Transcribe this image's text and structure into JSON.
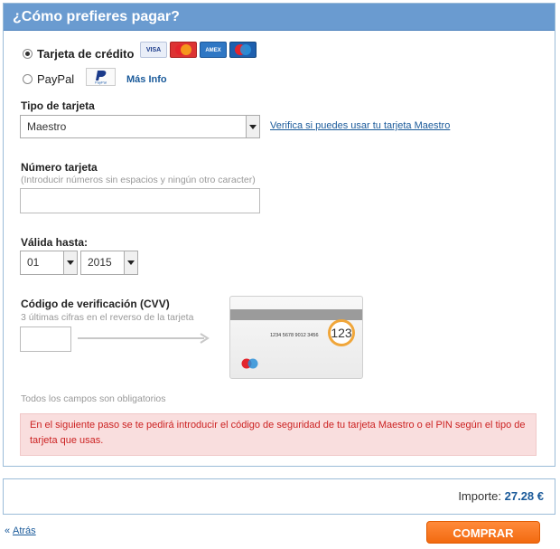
{
  "header": {
    "title": "¿Cómo prefieres pagar?"
  },
  "payment_methods": {
    "credit_card_label": "Tarjeta de crédito",
    "paypal_label": "PayPal",
    "more_info_link": "Más Info",
    "card_logos": [
      "VISA",
      "MasterCard",
      "AMEX",
      "Maestro"
    ],
    "paypal_logo_text": "PayPal",
    "selected": "Tarjeta de crédito"
  },
  "card_type": {
    "label": "Tipo de tarjeta",
    "value": "Maestro",
    "verify_link": "Verifica si puedes usar tu tarjeta Maestro"
  },
  "card_number": {
    "label": "Número tarjeta",
    "hint": "(Introducir números sin espacios y ningún otro caracter)",
    "value": ""
  },
  "expiry": {
    "label": "Válida hasta:",
    "month": "01",
    "year": "2015"
  },
  "cvv": {
    "label": "Código de verificación (CVV)",
    "hint": "3 últimas cifras en el reverso de la tarjeta",
    "value": "",
    "card_number_sample": "1234 5678 9012 3456",
    "code_sample": "123",
    "card_brand": "Maestro"
  },
  "required_note": "Todos los campos son obligatorios",
  "warning": "En el siguiente paso se te pedirá introducir el código de seguridad de tu tarjeta Maestro o el PIN según el tipo de tarjeta que usas.",
  "summary": {
    "amount_label": "Importe:",
    "amount_value": "27.28 €"
  },
  "footer": {
    "back_link": "Atrás",
    "back_prefix": "«",
    "buy_button": "COMPRAR"
  },
  "colors": {
    "header": "#6a9bd0",
    "accent_link": "#1a5a9a",
    "buy_button": "#f26a10",
    "warning_bg": "#f9dede",
    "warning_text": "#cc2222"
  }
}
